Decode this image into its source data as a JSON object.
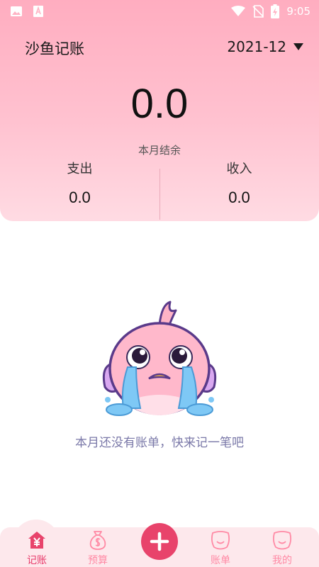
{
  "status_bar": {
    "time": "9:05",
    "icons": [
      "image-icon",
      "font-icon",
      "wifi-icon",
      "no-sim-icon",
      "battery-charging-icon"
    ]
  },
  "header": {
    "app_title": "沙鱼记账",
    "month": "2021-12",
    "balance_value": "0.0",
    "balance_label": "本月结余",
    "expense_label": "支出",
    "expense_value": "0.0",
    "income_label": "收入",
    "income_value": "0.0"
  },
  "empty_state": {
    "message": "本月还没有账单，快来记一笔吧",
    "illustration": "crying-bird-mascot"
  },
  "tabbar": {
    "tabs": [
      {
        "label": "记账",
        "icon": "house-yen-icon",
        "active": true
      },
      {
        "label": "预算",
        "icon": "money-bag-icon",
        "active": false
      },
      {
        "label": "账单",
        "icon": "face-icon",
        "active": false
      },
      {
        "label": "我的",
        "icon": "face-icon",
        "active": false
      }
    ],
    "add_icon": "plus-icon"
  },
  "colors": {
    "header_top": "#ffadc0",
    "header_bottom": "#ffdbe3",
    "accent": "#e8436b",
    "tab_inactive": "#ff8aa5",
    "empty_text": "#7a78a8",
    "tabbar_bg": "#fde8ec"
  }
}
